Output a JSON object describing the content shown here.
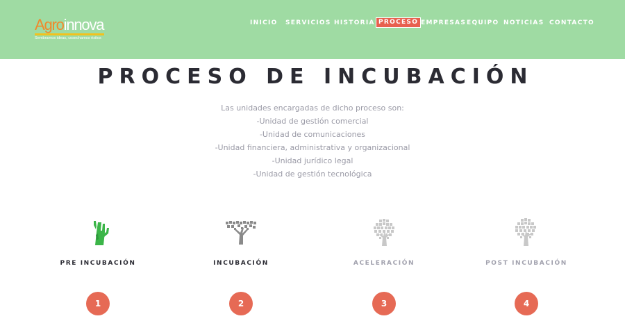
{
  "logo": {
    "agro": "Agro",
    "innova": "innova",
    "tagline": "Sembramos ideas, cosechamos éxitos"
  },
  "nav": {
    "items": [
      "INICIO",
      "SERVICIOS",
      "HISTORIA",
      "PROCESO",
      "EMPRESAS",
      "EQUIPO",
      "NOTICIAS",
      "CONTACTO"
    ],
    "active": "PROCESO"
  },
  "main": {
    "title": "PROCESO DE INCUBACIÓN",
    "description": [
      "Las unidades encargadas de dicho proceso son:",
      "-Unidad de gestión comercial",
      "-Unidad de comunicaciones",
      "-Unidad financiera, administrativa y organizacional",
      "-Unidad jurídico legal",
      "-Unidad de gestión tecnológica"
    ]
  },
  "stages": [
    {
      "label": "PRE INCUBACIÓN",
      "number": "1",
      "icon": "cactus-icon"
    },
    {
      "label": "INCUBACIÓN",
      "number": "2",
      "icon": "acacia-tree-icon"
    },
    {
      "label": "ACELERACIÓN",
      "number": "3",
      "icon": "round-tree-icon"
    },
    {
      "label": "POST INCUBACIÓN",
      "number": "4",
      "icon": "large-tree-icon"
    }
  ],
  "colors": {
    "header": "#9fdba3",
    "accent": "#e66a55",
    "cactus": "#3bb548",
    "tree_dark": "#8a8a8a",
    "tree_light": "#c8c8c8"
  }
}
